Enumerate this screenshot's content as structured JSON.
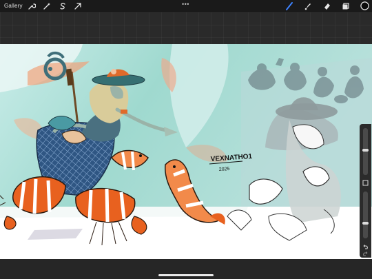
{
  "topbar": {
    "gallery_label": "Gallery",
    "more_dots": "•••",
    "left_tools": [
      "wrench-icon",
      "magic-wand-icon",
      "selection-s-icon",
      "transform-arrow-icon"
    ],
    "right_tools": [
      "brush-icon",
      "smudge-icon",
      "eraser-icon",
      "layers-icon",
      "color-swatch"
    ],
    "active_tool_color": "#3d82ff",
    "current_color": "#0b0b0b"
  },
  "canvas": {
    "signature_text": "VEXNATHO1",
    "signature_year": "2025",
    "background_color": "#9fd9cf",
    "stripe_color": "#e8611f"
  },
  "sidebar": {
    "size_slider_level": 0.55,
    "opacity_slider_level": 0.35,
    "undo_icon": "undo-arrow-icon",
    "modify_icon": "square-icon"
  }
}
